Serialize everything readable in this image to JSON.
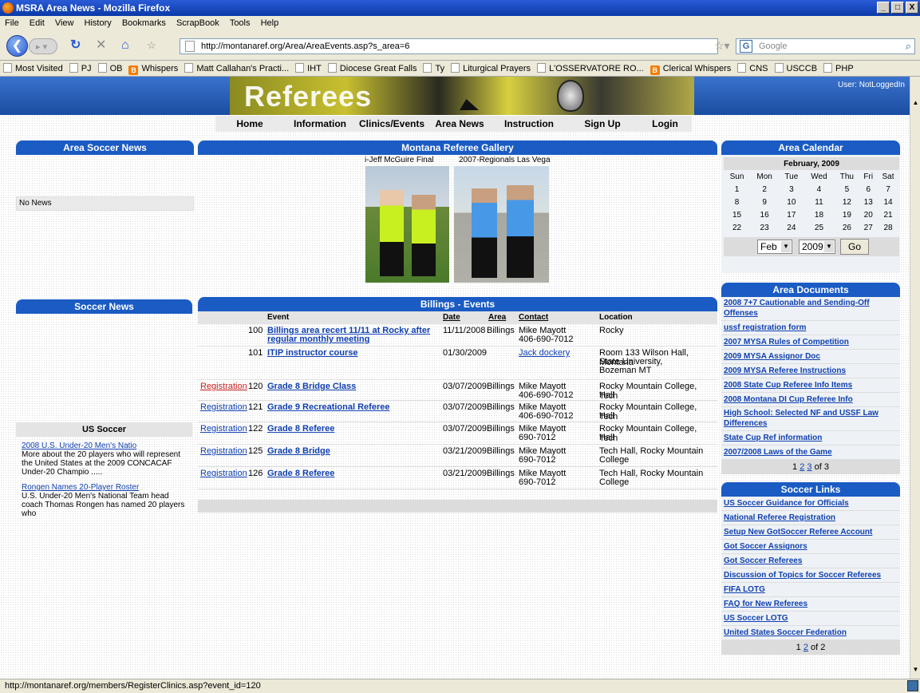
{
  "window": {
    "title": "MSRA Area News - Mozilla Firefox",
    "controls": [
      "_",
      "□",
      "X"
    ]
  },
  "menu": [
    "File",
    "Edit",
    "View",
    "History",
    "Bookmarks",
    "ScrapBook",
    "Tools",
    "Help"
  ],
  "toolbar": {
    "url": "http://montanaref.org/Area/AreaEvents.asp?s_area=6",
    "search_placeholder": "Google"
  },
  "bookmarks": [
    {
      "label": "Most Visited",
      "icon": "bookmark-icon"
    },
    {
      "label": "PJ",
      "icon": "page-icon"
    },
    {
      "label": "OB",
      "icon": "page-icon"
    },
    {
      "label": "Whispers",
      "icon": "blogger-icon"
    },
    {
      "label": "Matt Callahan's Practi...",
      "icon": "page-icon"
    },
    {
      "label": "IHT",
      "icon": "iht-icon"
    },
    {
      "label": "Diocese Great Falls",
      "icon": "page-icon"
    },
    {
      "label": "Ty",
      "icon": "wordpress-icon"
    },
    {
      "label": "Liturgical Prayers",
      "icon": "page-icon"
    },
    {
      "label": "L'OSSERVATORE RO...",
      "icon": "page-icon"
    },
    {
      "label": "Clerical Whispers",
      "icon": "blogger-icon"
    },
    {
      "label": "CNS",
      "icon": "page-icon"
    },
    {
      "label": "USCCB",
      "icon": "page-icon"
    },
    {
      "label": "PHP",
      "icon": "page-icon"
    }
  ],
  "site": {
    "banner_title": "Referees",
    "user": "User: NotLoggedIn",
    "nav": [
      "Home",
      "Information",
      "Clinics/Events",
      "Area News",
      "Instruction",
      "Sign Up",
      "Login"
    ]
  },
  "area_news": {
    "title": "Area Soccer News",
    "empty_text": "No News"
  },
  "soccer_news": {
    "title": "Soccer News",
    "us_soccer_title": "US Soccer",
    "items": [
      {
        "link": "2008 U.S. Under-20 Men's Natio",
        "text": "More about the 20 players who will represent the United States at the 2009 CONCACAF Under-20 Champio ....."
      },
      {
        "link": "Rongen Names 20-Player Roster",
        "text": "U.S. Under-20 Men's National Team head coach Thomas Rongen has named 20 players who"
      }
    ]
  },
  "gallery": {
    "title": "Montana Referee Gallery",
    "photos": [
      {
        "caption": "i-Jeff McGuire Final"
      },
      {
        "caption": "2007-Regionals Las Vega"
      }
    ]
  },
  "events": {
    "title": "Billings - Events",
    "headers": [
      "Event",
      "Date",
      "Area",
      "Contact",
      "Location"
    ],
    "rows": [
      {
        "reg": "",
        "id": "100",
        "event": "Billings area recert 11/11 at Rocky after",
        "event2": "regular monthly meeting",
        "date": "11/11/2008",
        "area": "Billings",
        "contact": "Mike Mayott",
        "contact2": "406-690-7012",
        "location": "Rocky",
        "location2": ""
      },
      {
        "reg": "",
        "id": "101",
        "event": "ITIP instructor course",
        "event2": "",
        "date": "01/30/2009",
        "area": "",
        "contact": "Jack dockery",
        "contact2": "",
        "location": "Room 133 Wilson Hall, Montana",
        "location2": "State University,",
        "location3": "Bozeman MT"
      },
      {
        "reg": "Registration",
        "id": "120",
        "event": "Grade 8 Bridge Class",
        "event2": "",
        "date": "03/07/2009",
        "area": "Billings",
        "contact": "Mike Mayott",
        "contact2": "406-690-7012",
        "location": "Rocky Mountain College, Tech",
        "location2": "Hall"
      },
      {
        "reg": "Registration",
        "id": "121",
        "event": "Grade 9 Recreational Referee",
        "event2": "",
        "date": "03/07/2009",
        "area": "Billings",
        "contact": "Mike Mayott",
        "contact2": "406-690-7012",
        "location": "Rocky Mountain College, Tech",
        "location2": "Hall"
      },
      {
        "reg": "Registration",
        "id": "122",
        "event": "Grade 8 Referee",
        "event2": "",
        "date": "03/07/2009",
        "area": "Billings",
        "contact": "Mike Mayott",
        "contact2": "690-7012",
        "location": "Rocky Mountain College, Tech",
        "location2": "Hall"
      },
      {
        "reg": "Registration",
        "id": "125",
        "event": "Grade 8 Bridge",
        "event2": "",
        "date": "03/21/2009",
        "area": "Billings",
        "contact": "Mike Mayott",
        "contact2": "690-7012",
        "location": "Tech Hall, Rocky Mountain",
        "location2": "College"
      },
      {
        "reg": "Registration",
        "id": "126",
        "event": "Grade 8 Referee",
        "event2": "",
        "date": "03/21/2009",
        "area": "Billings",
        "contact": "Mike Mayott",
        "contact2": "690-7012",
        "location": "Tech Hall, Rocky Mountain",
        "location2": "College"
      }
    ]
  },
  "calendar": {
    "title": "Area Calendar",
    "month_label": "February, 2009",
    "weekdays": [
      "Sun",
      "Mon",
      "Tue",
      "Wed",
      "Thu",
      "Fri",
      "Sat"
    ],
    "weeks": [
      [
        "1",
        "2",
        "3",
        "4",
        "5",
        "6",
        "7"
      ],
      [
        "8",
        "9",
        "10",
        "11",
        "12",
        "13",
        "14"
      ],
      [
        "15",
        "16",
        "17",
        "18",
        "19",
        "20",
        "21"
      ],
      [
        "22",
        "23",
        "24",
        "25",
        "26",
        "27",
        "28"
      ]
    ],
    "month_select": "Feb",
    "year_select": "2009",
    "go_label": "Go"
  },
  "documents": {
    "title": "Area Documents",
    "items": [
      "2008 7+7 Cautionable and Sending-Off Offenses",
      "ussf registration form",
      "2007 MYSA Rules of Competition",
      "2009 MYSA Assignor Doc",
      "2009 MYSA Referee Instructions",
      "2008 State Cup Referee Info Items",
      "2008 Montana DI Cup Referee Info",
      "High School: Selected NF and USSF Law Differences",
      "State Cup Ref information",
      "2007/2008 Laws of the Game"
    ],
    "pager_pages": [
      "1",
      "2",
      "3"
    ],
    "pager_suffix": "of 3"
  },
  "links": {
    "title": "Soccer Links",
    "items": [
      "US Soccer Guidance for Officials",
      "National Referee Registration",
      "Setup New GotSoccer Referee Account",
      "Got Soccer Assignors",
      "Got Soccer Referees",
      "Discussion of Topics for Soccer Referees",
      "FIFA LOTG",
      "FAQ for New Referees",
      "US Soccer LOTG",
      "United States Soccer Federation"
    ],
    "pager_pages": [
      "1",
      "2"
    ],
    "pager_suffix": "of 2"
  },
  "status": {
    "text": "http://montanaref.org/members/RegisterClinics.asp?event_id=120"
  }
}
